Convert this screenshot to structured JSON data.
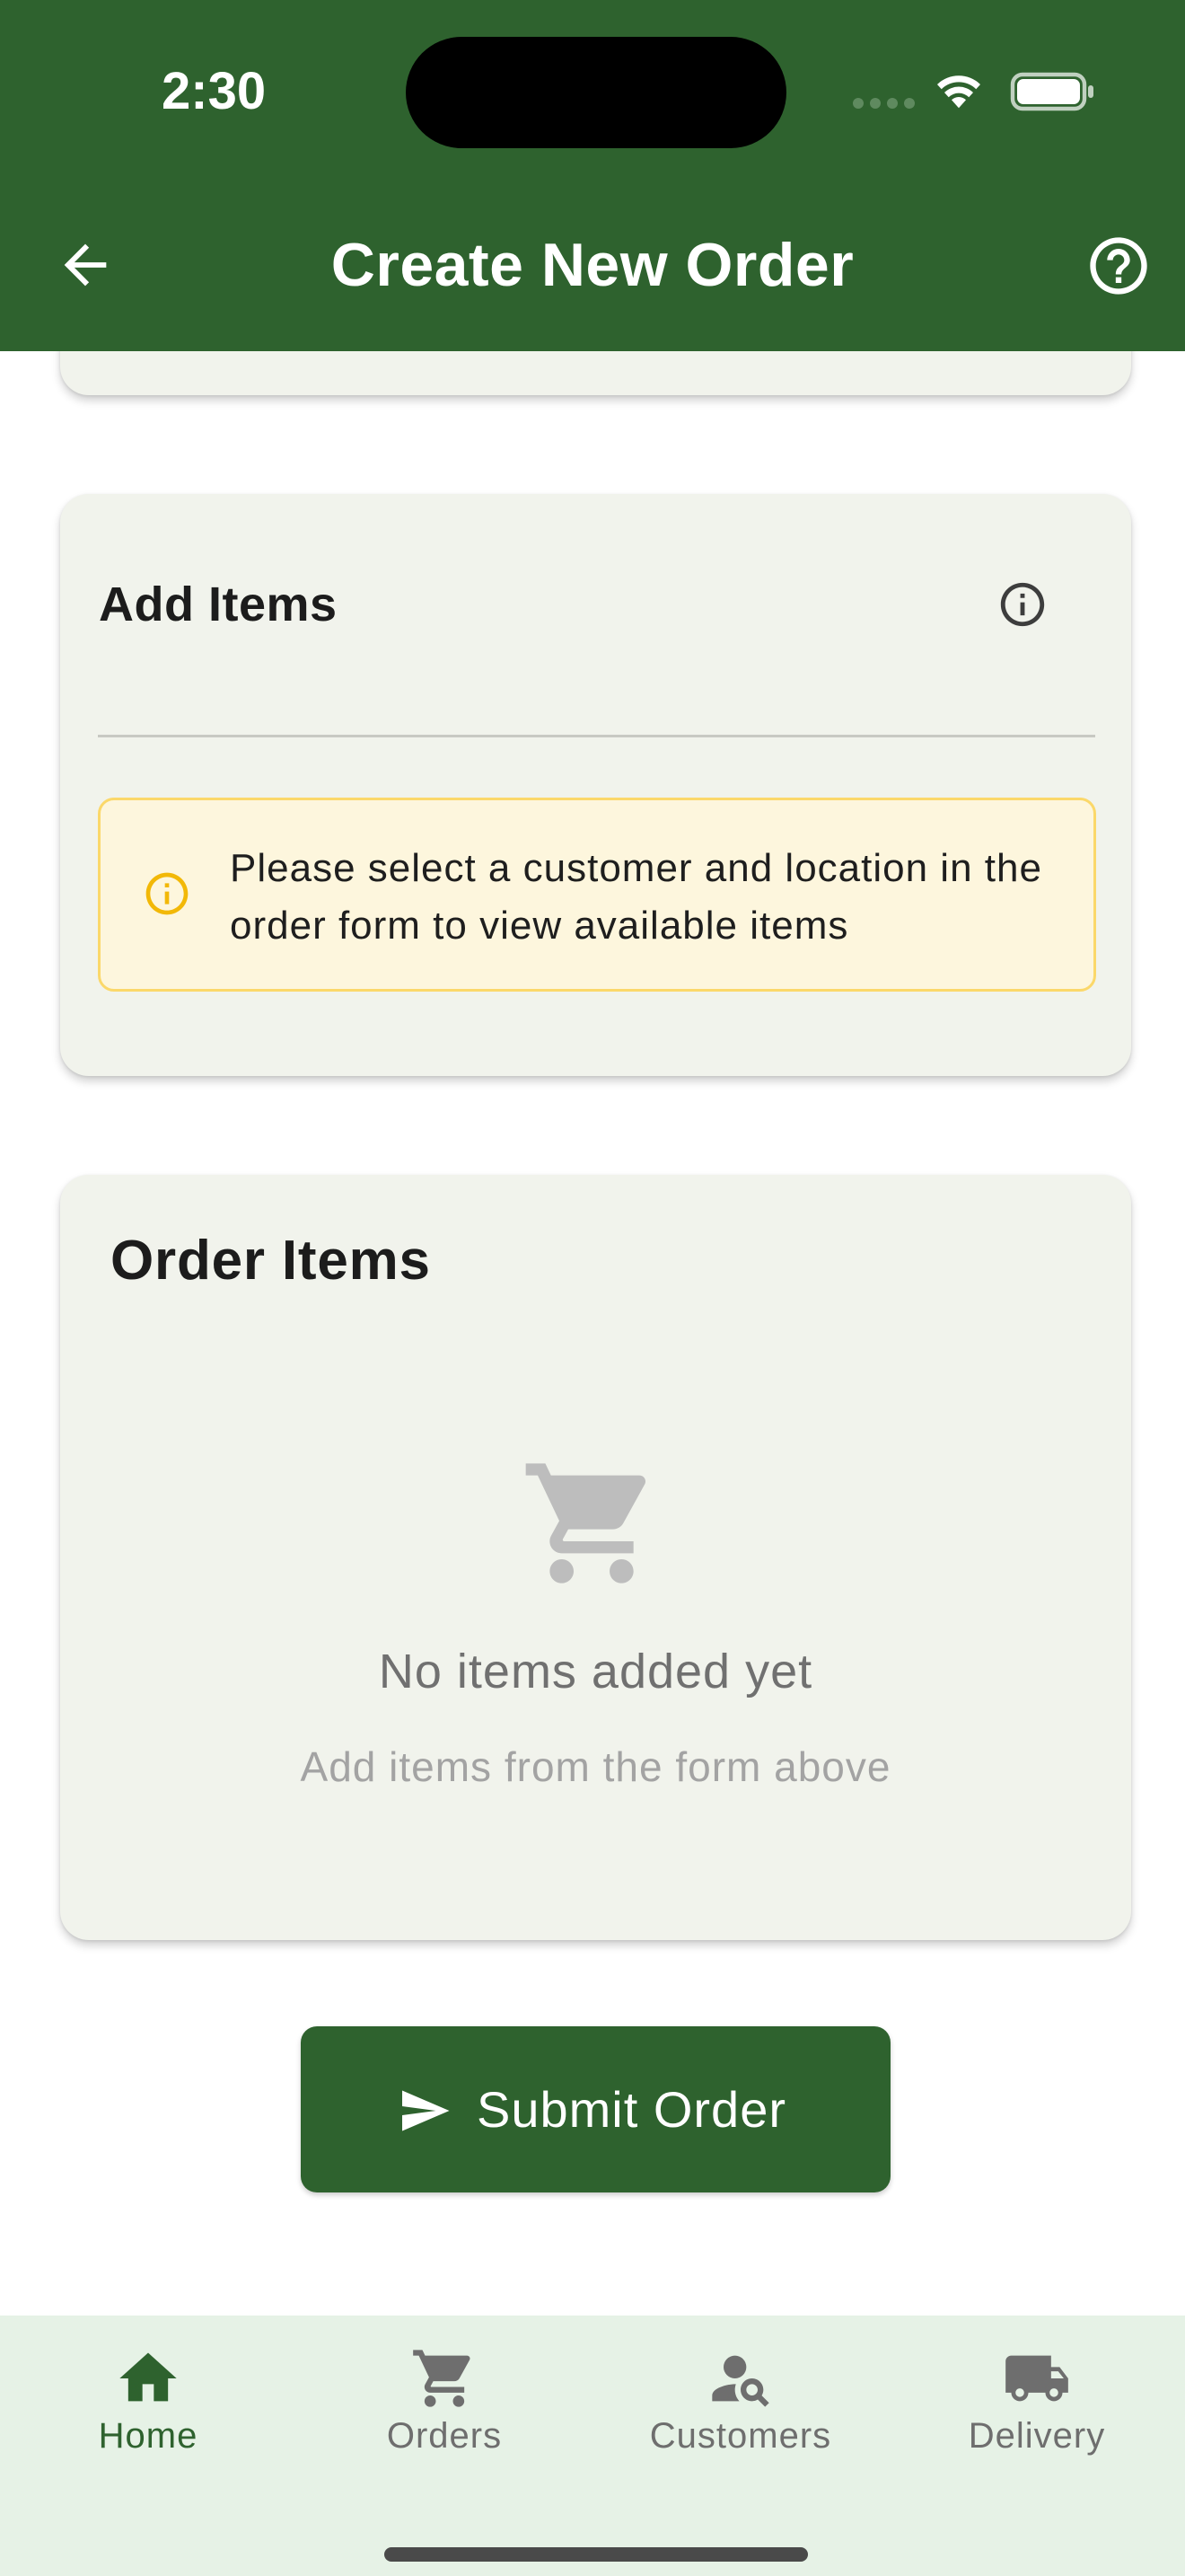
{
  "status_bar": {
    "time": "2:30"
  },
  "header": {
    "title": "Create New Order",
    "back_icon": "arrow-back-icon",
    "help_icon": "help-circle-icon"
  },
  "add_items": {
    "title": "Add Items",
    "info_icon": "info-icon",
    "notice_text": "Please select a customer and location in the order form to view available items"
  },
  "order_items": {
    "title": "Order Items",
    "empty_icon": "cart-icon",
    "empty_title": "No items added yet",
    "empty_subtitle": "Add items from the form above"
  },
  "submit": {
    "label": "Submit Order",
    "icon": "send-icon"
  },
  "bottom_nav": {
    "items": [
      {
        "label": "Home",
        "icon": "home-icon",
        "active": true
      },
      {
        "label": "Orders",
        "icon": "cart-icon",
        "active": false
      },
      {
        "label": "Customers",
        "icon": "person-search-icon",
        "active": false
      },
      {
        "label": "Delivery",
        "icon": "truck-icon",
        "active": false
      }
    ]
  },
  "colors": {
    "primary": "#2e622e",
    "card_background": "#f1f3ec",
    "notice_background": "#fdf6dd",
    "notice_border": "#fbd86a",
    "nav_background": "#e6f2e6",
    "warning_icon": "#f2b807"
  }
}
